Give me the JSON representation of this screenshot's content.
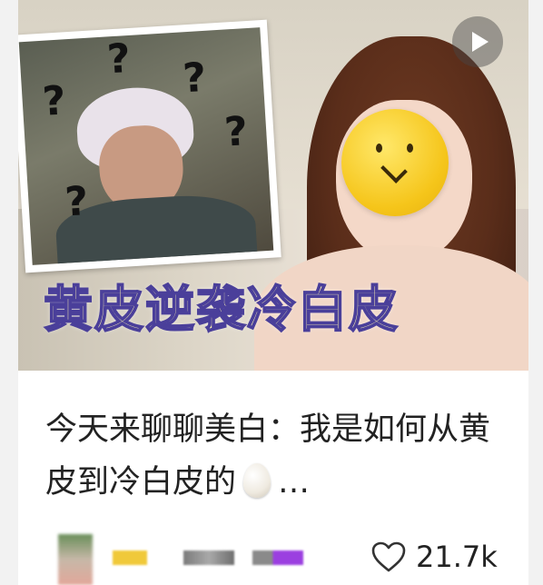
{
  "post": {
    "cover": {
      "overlay_text": "黄皮逆袭冷白皮",
      "meme_marks": [
        "?",
        "?",
        "?",
        "?",
        "?"
      ],
      "play_icon": "play-icon"
    },
    "title": "今天来聊聊美白：我是如何从黄皮到冷白皮的",
    "title_icon": "egg-icon",
    "ellipsis": "…",
    "author": {
      "avatar_icon": "avatar",
      "name_blurred": true
    },
    "likes": {
      "icon": "heart-outline-icon",
      "count": "21.7k"
    }
  },
  "colors": {
    "overlay_text": "#fff6b0",
    "overlay_stroke": "#4a3f9a",
    "text": "#222222",
    "name_blocks": [
      "#f0c93a",
      "#8a8a8a",
      "#9b3fe0"
    ]
  }
}
